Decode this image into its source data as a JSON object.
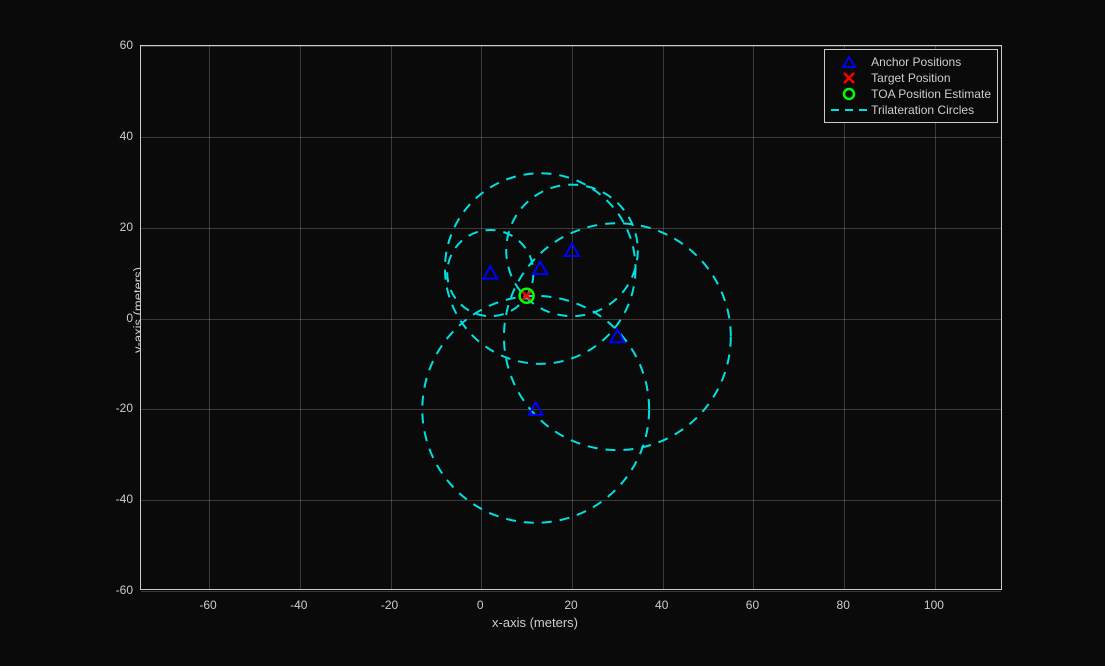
{
  "chart_data": {
    "type": "scatter",
    "title": "",
    "xlabel": "x-axis (meters)",
    "ylabel": "y-axis (meters)",
    "xlim": [
      -75,
      115
    ],
    "ylim": [
      -60,
      60
    ],
    "x_ticks": [
      -60,
      -40,
      -20,
      0,
      20,
      40,
      60,
      80,
      100
    ],
    "y_ticks": [
      -60,
      -40,
      -20,
      0,
      20,
      40,
      60
    ],
    "legend": [
      "Anchor Positions",
      "Target Position",
      "TOA Position Estimate",
      "Trilateration Circles"
    ],
    "series": {
      "anchors": [
        {
          "x": 2,
          "y": 10
        },
        {
          "x": 13,
          "y": 11
        },
        {
          "x": 20,
          "y": 15
        },
        {
          "x": 30,
          "y": -4
        },
        {
          "x": 12,
          "y": -20
        }
      ],
      "target": {
        "x": 10,
        "y": 5
      },
      "estimate": {
        "x": 10,
        "y": 5
      },
      "circles": [
        {
          "cx": 2,
          "cy": 10,
          "r": 9.5
        },
        {
          "cx": 13,
          "cy": 11,
          "r": 21
        },
        {
          "cx": 20,
          "cy": 15,
          "r": 14.5
        },
        {
          "cx": 30,
          "cy": -4,
          "r": 25
        },
        {
          "cx": 12,
          "cy": -20,
          "r": 25
        }
      ]
    }
  }
}
